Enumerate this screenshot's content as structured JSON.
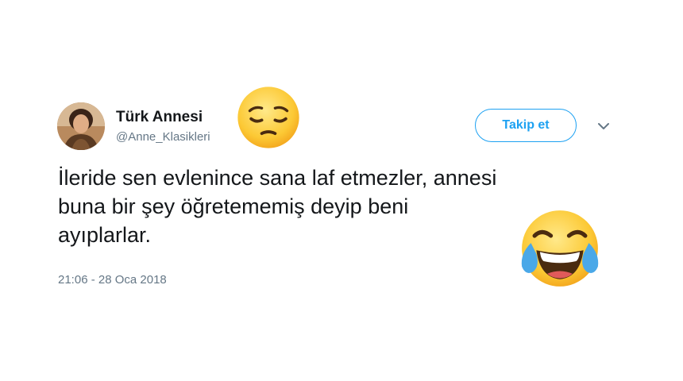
{
  "user": {
    "display_name": "Türk Annesi",
    "handle": "@Anne_Klasikleri"
  },
  "follow_button": {
    "label": "Takip et"
  },
  "tweet": {
    "lines": [
      "İleride sen evlenince sana laf etmezler, annesi",
      "buna bir şey öğretememiş deyip beni",
      "ayıplarlar."
    ],
    "timestamp": "21:06 - 28 Oca 2018"
  },
  "icons": {
    "menu": "chevron-down-icon",
    "emoji_1": "pensive-face-emoji",
    "emoji_2": "face-with-tears-of-joy-emoji"
  },
  "colors": {
    "accent": "#1da1f2",
    "text": "#14171a",
    "secondary": "#657786"
  }
}
